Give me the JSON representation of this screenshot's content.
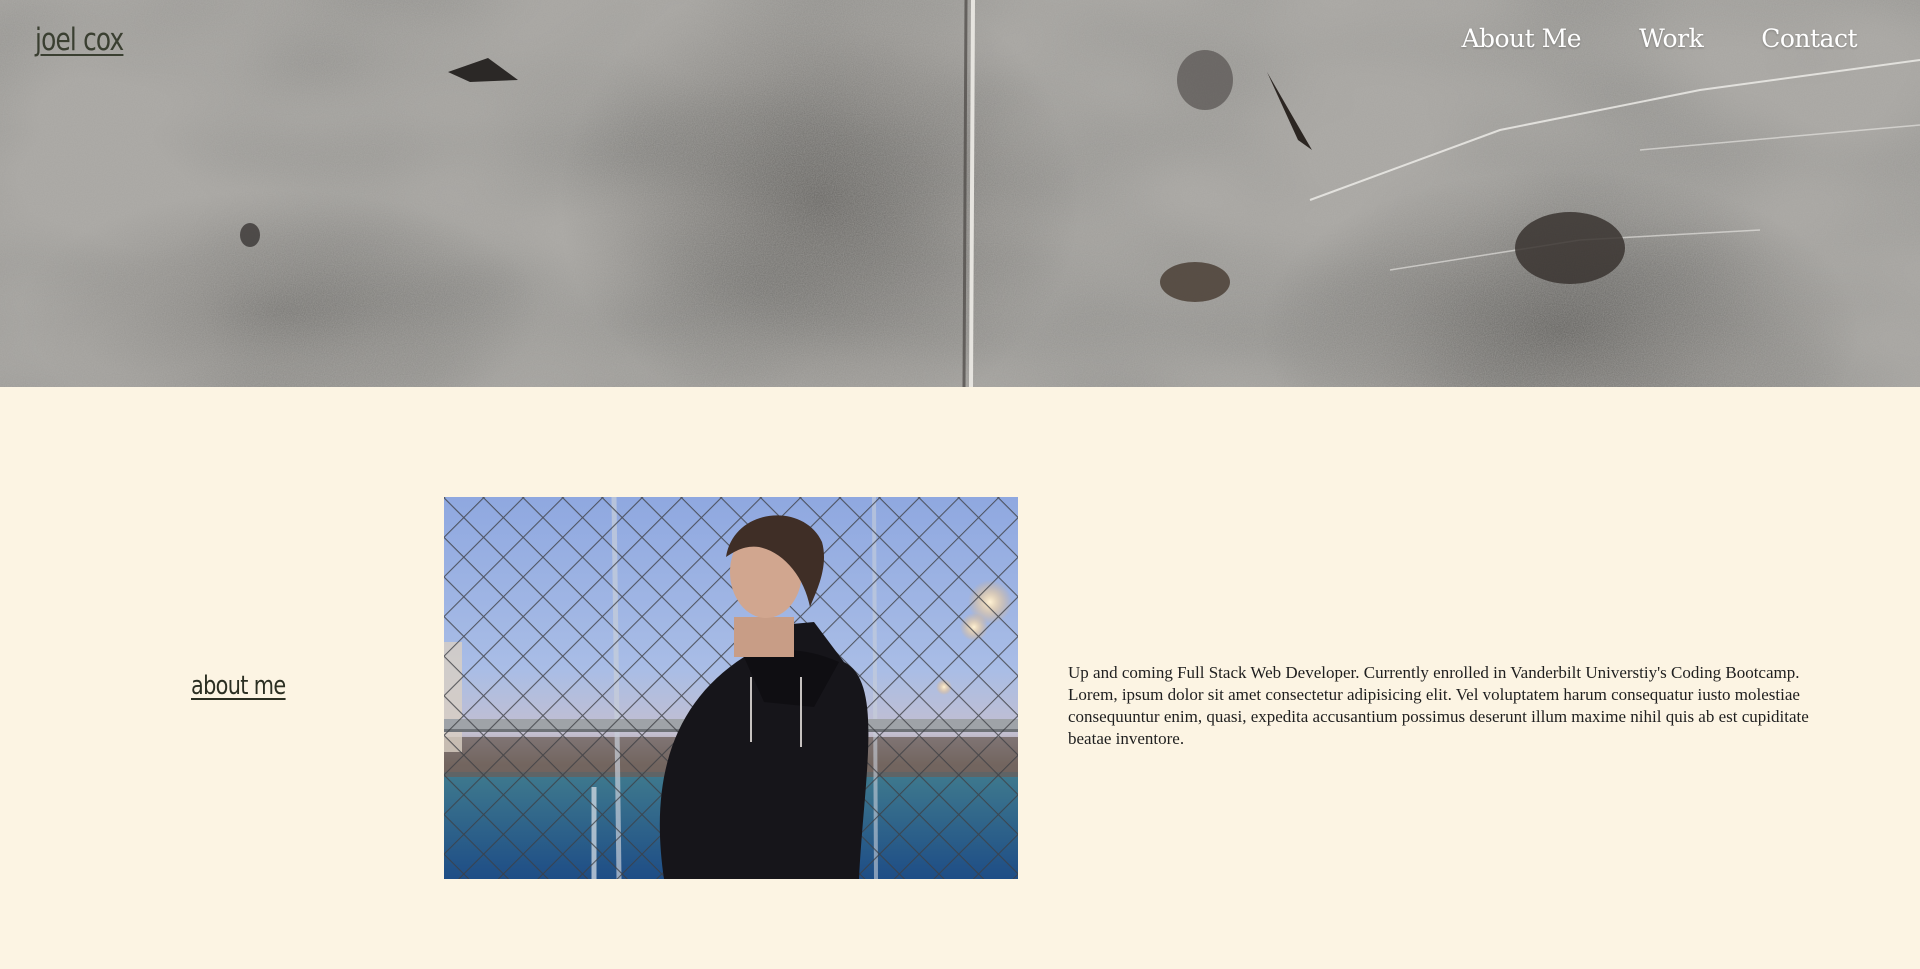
{
  "header": {
    "brand": "joel cox",
    "nav": [
      {
        "label": "About Me"
      },
      {
        "label": "Work"
      },
      {
        "label": "Contact"
      }
    ]
  },
  "about": {
    "heading": "about me",
    "body": "Up and coming Full Stack Web Developer. Currently enrolled in Vanderbilt Universtiy's Coding Bootcamp. Lorem, ipsum dolor sit amet consectetur adipisicing elit. Vel voluptatem harum consequatur iusto molestiae consequuntur enim, quasi, expedita accusantium possimus deserunt illum maxime nihil quis ab est cupiditate beatae inventore."
  },
  "colors": {
    "page_background": "#fcf4e3",
    "brand_text": "#3a3f31",
    "nav_text": "#ffffff",
    "body_text": "#1f1f1f"
  },
  "images": {
    "hero": "concrete-wall-texture",
    "portrait": "man-in-black-hoodie-by-chain-link-fence"
  }
}
